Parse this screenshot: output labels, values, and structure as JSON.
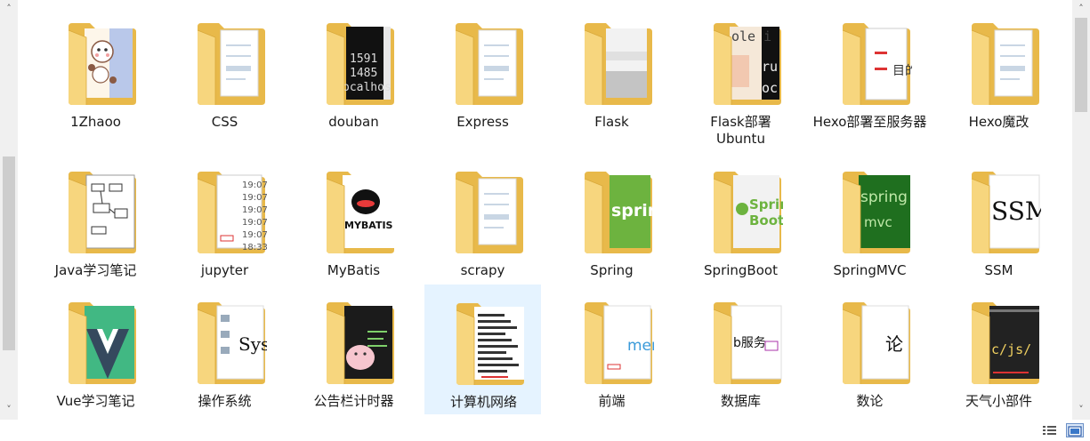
{
  "folders": [
    {
      "name": "1Zhaoo",
      "preview": "cartoon"
    },
    {
      "name": "CSS",
      "preview": "doc"
    },
    {
      "name": "douban",
      "preview": "terminal",
      "snippet": [
        "1591",
        "1485",
        "ocalhos"
      ]
    },
    {
      "name": "Express",
      "preview": "doc"
    },
    {
      "name": "Flask",
      "preview": "gray"
    },
    {
      "name": "Flask部署Ubuntu",
      "preview": "terminal2",
      "snippet": [
        "ole i",
        "ru",
        "oc"
      ]
    },
    {
      "name": "Hexo部署至服务器",
      "preview": "doc2",
      "snippet": [
        "目的"
      ]
    },
    {
      "name": "Hexo魔改",
      "preview": "plain"
    },
    {
      "name": "Java学习笔记",
      "preview": "diagram"
    },
    {
      "name": "jupyter",
      "preview": "list",
      "snippet": [
        "19:07",
        "19:07",
        "19:07",
        "19:07",
        "19:07",
        "18:33"
      ]
    },
    {
      "name": "MyBatis",
      "preview": "mybatis",
      "snippet": [
        "MYBATIS"
      ]
    },
    {
      "name": "scrapy",
      "preview": "plain"
    },
    {
      "name": "Spring",
      "preview": "spring",
      "snippet": [
        "spring"
      ]
    },
    {
      "name": "SpringBoot",
      "preview": "springboot",
      "snippet": [
        "Spring",
        "Boot"
      ]
    },
    {
      "name": "SpringMVC",
      "preview": "springmvc",
      "snippet": [
        "spring",
        "mvc"
      ]
    },
    {
      "name": "SSM",
      "preview": "ssm",
      "snippet": [
        "SSM"
      ]
    },
    {
      "name": "Vue学习笔记",
      "preview": "vue"
    },
    {
      "name": "操作系统",
      "preview": "os",
      "snippet": [
        "Sys"
      ]
    },
    {
      "name": "公告栏计时器",
      "preview": "pig"
    },
    {
      "name": "计算机网络",
      "preview": "network"
    },
    {
      "name": "前端",
      "preview": "frontend",
      "snippet": [
        "men"
      ]
    },
    {
      "name": "数据库",
      "preview": "db",
      "snippet": [
        "b服务"
      ]
    },
    {
      "name": "数论",
      "preview": "math",
      "snippet": [
        "论"
      ]
    },
    {
      "name": "天气小部件",
      "preview": "code",
      "snippet": [
        "c/js/"
      ]
    }
  ],
  "selected_folder": "计算机网络",
  "status_bar": {
    "details_view": "details-view-icon",
    "large_icons_view": "large-icons-view-icon"
  },
  "colors": {
    "folder_back": "#e8b94a",
    "folder_front": "#f7d67e",
    "selection": "#e5f3ff",
    "spring_green": "#6db33f"
  }
}
